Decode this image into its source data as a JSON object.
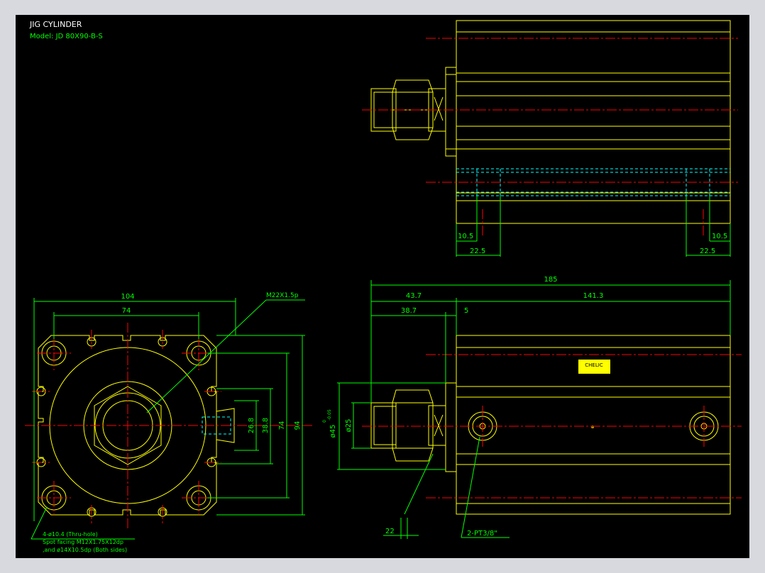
{
  "title": {
    "name": "JIG CYLINDER",
    "model": "Model: JD 80X90-B-S"
  },
  "top_view": {
    "dim_left_inner": "10.5",
    "dim_left_outer": "22.5",
    "dim_right_inner": "10.5",
    "dim_right_outer": "22.5"
  },
  "front_view": {
    "dim_width_outer": "104",
    "dim_width_inner": "74",
    "dim_port_small": "26.8",
    "dim_port_large": "38.8",
    "dim_height_inner": "74",
    "dim_height_outer": "94",
    "thread_callout": "M22X1.5p",
    "note_line1": "4-ø10.4 (Thru-hole)",
    "note_line2": "Spot facing  M12X1.75X12dp",
    "note_line3": ",and ø14X10.5dp (Both sides)"
  },
  "side_view": {
    "dim_total": "185",
    "dim_rod_ext": "43.7",
    "dim_body": "141.3",
    "dim_rod": "38.7",
    "dim_flange": "5",
    "dim_dia_outer": "ø45",
    "dim_dia_tol_upper": "0",
    "dim_dia_tol_lower": "-0.05",
    "dim_dia_inner": "ø25",
    "dim_bottom": "22",
    "port_callout": "2-PT3/8\"",
    "nameplate": "CHELIC",
    "center_mark": "⊕"
  },
  "colors": {
    "background": "#000000",
    "outline": "#ffff00",
    "dimension": "#00ff00",
    "centerline": "#ff0000",
    "hidden": "#00ffff",
    "text": "#ffffff",
    "frame": "#d7d9de"
  }
}
